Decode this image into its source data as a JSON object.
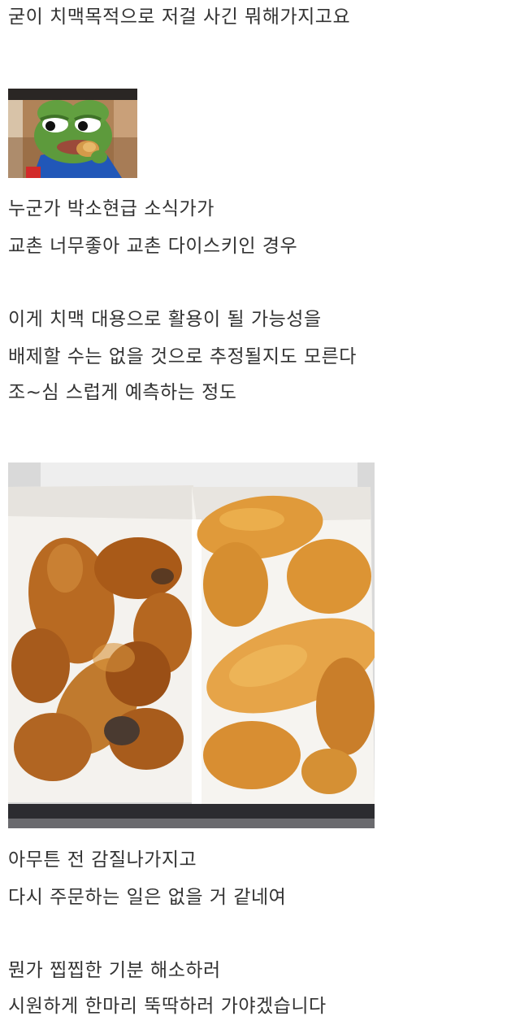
{
  "post": {
    "lines": [
      "굳이 치맥목적으로 저걸 사긴 뭐해가지고요",
      "누군가 박소현급 소식가가",
      "교촌 너무좋아 교촌 다이스키인 경우",
      "이게 치맥 대용으로 활용이 될 가능성을",
      "배제할 수는 없을 것으로 추정될지도 모른다",
      "조~심 스럽게 예측하는 정도",
      "아무튼 전 감질나가지고",
      "다시 주문하는 일은 없을 거 같네여",
      "뭔가 찝찝한 기분 해소하러",
      "시원하게 한마리 뚝딱하러 가야겠습니다"
    ]
  },
  "images": {
    "pepe": "pepe-frog-eating-chicken-meme",
    "chicken": "fried-chicken-in-paper-boxes-photo"
  },
  "colors": {
    "text": "#333333",
    "background": "#ffffff"
  }
}
